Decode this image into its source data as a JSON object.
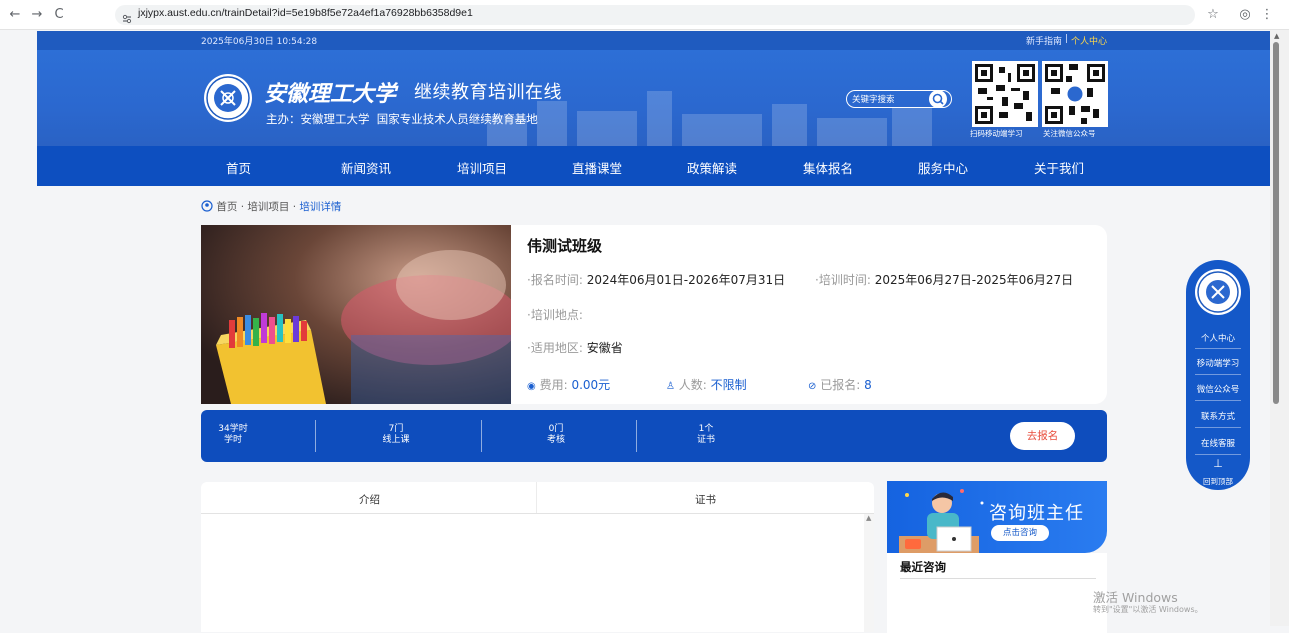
{
  "browser": {
    "url": "jxjypx.aust.edu.cn/trainDetail?id=5e19b8f5e72a4ef1a76928bb6358d9e1"
  },
  "topbar": {
    "datetime": "2025年06月30日 10:54:28",
    "guide": "新手指南",
    "separator": "|",
    "personal": "个人中心"
  },
  "header": {
    "logo_text": "安徽理工大学",
    "title": "继续教育培训在线",
    "subtitle": "主办：安徽理工大学  国家专业技术人员继续教育基地",
    "search_placeholder": "关键字搜索",
    "qr1_caption": "扫码移动端学习",
    "qr2_caption": "关注微信公众号"
  },
  "nav": {
    "items": [
      "首页",
      "新闻资讯",
      "培训项目",
      "直播课堂",
      "政策解读",
      "集体报名",
      "服务中心",
      "关于我们"
    ]
  },
  "breadcrumb": {
    "home": "首页",
    "sep": "·",
    "projects": "培训项目",
    "current": "培训详情"
  },
  "course": {
    "title": "伟测试班级",
    "signup_label": "·报名时间:",
    "signup_value": "2024年06月01日-2026年07月31日",
    "train_label": "·培训时间:",
    "train_value": "2025年06月27日-2025年06月27日",
    "location_label": "·培训地点:",
    "location_value": "",
    "region_label": "·适用地区:",
    "region_value": "安徽省",
    "fee_label": "费用:",
    "fee_value": "0.00元",
    "people_label": "人数:",
    "people_value": "不限制",
    "enrolled_label": "已报名:",
    "enrolled_value": "8"
  },
  "stats": [
    {
      "value": "34学时",
      "label": "学时"
    },
    {
      "value": "7门",
      "label": "线上课"
    },
    {
      "value": "0门",
      "label": "考核"
    },
    {
      "value": "1个",
      "label": "证书"
    }
  ],
  "signup_button": "去报名",
  "tabs": [
    "介绍",
    "证书"
  ],
  "consult": {
    "banner_title": "咨询班主任",
    "banner_button": "点击咨询",
    "recent_title": "最近咨询"
  },
  "side_float": {
    "items": [
      "个人中心",
      "移动端学习",
      "微信公众号",
      "联系方式",
      "在线客服",
      "回到顶部"
    ]
  },
  "watermark": {
    "line1": "激活 Windows",
    "line2": "转到\"设置\"以激活 Windows。"
  },
  "colors": {
    "primary": "#0d4fc0",
    "header": "#2b68cf",
    "accent_red": "#e84d3c",
    "link_blue": "#1a5fd0"
  }
}
